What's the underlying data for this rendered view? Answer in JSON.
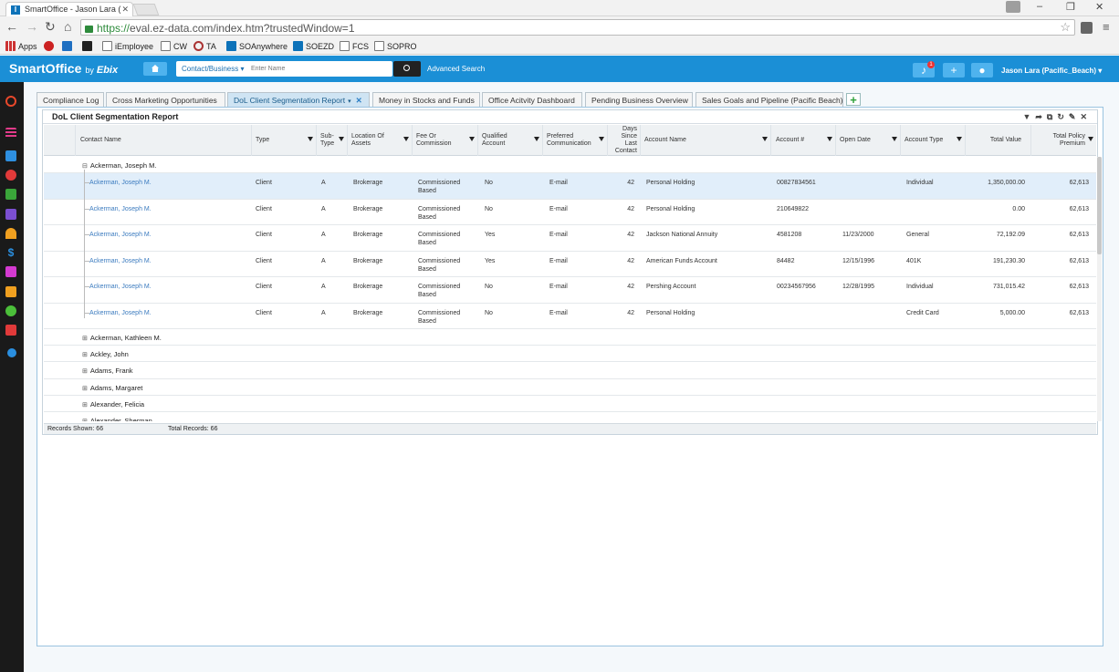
{
  "browser": {
    "tab_title": "SmartOffice - Jason Lara (",
    "url_https": "https://",
    "url_rest": "eval.ez-data.com/index.htm?trustedWindow=1",
    "bookmarks": [
      "Apps",
      "",
      "",
      "",
      "iEmployee",
      "CW",
      "TA",
      "SOAnywhere",
      "SOEZD",
      "FCS",
      "SOPRO"
    ]
  },
  "header": {
    "logo": "SmartOffice",
    "logo_by": "by",
    "logo_ebix": "Ebix",
    "search_scope": "Contact/Business ▾",
    "search_placeholder": "Enter Name",
    "advanced_search": "Advanced Search",
    "notification_count": "1",
    "user_name": "Jason Lara (Pacific_Beach) ▾"
  },
  "tabs": [
    {
      "label": "Compliance Log"
    },
    {
      "label": "Cross Marketing Opportunities"
    },
    {
      "label": "DoL Client Segmentation Report"
    },
    {
      "label": "Money in Stocks and Funds"
    },
    {
      "label": "Office Acitvity Dashboard"
    },
    {
      "label": "Pending Business Overview"
    },
    {
      "label": "Sales Goals and Pipeline (Pacific Beach)"
    }
  ],
  "report": {
    "title": "DoL Client Segmentation Report",
    "columns": {
      "contact_name": "Contact Name",
      "type": "Type",
      "sub_type_1": "Sub-",
      "sub_type_2": "Type",
      "location_1": "Location Of",
      "location_2": "Assets",
      "fee_1": "Fee Or",
      "fee_2": "Commission",
      "qualified_1": "Qualified",
      "qualified_2": "Account",
      "preferred_1": "Preferred",
      "preferred_2": "Communication",
      "days_1": "Days",
      "days_2": "Since",
      "days_3": "Last",
      "days_4": "Contact",
      "account_name": "Account Name",
      "account_num": "Account #",
      "open_date": "Open Date",
      "account_type": "Account Type",
      "total_value": "Total Value",
      "premium_1": "Total Policy",
      "premium_2": "Premium"
    },
    "expanded_group": "Ackerman, Joseph M.",
    "rows": [
      {
        "name": "Ackerman, Joseph M.",
        "type": "Client",
        "sub": "A",
        "loc": "Brokerage",
        "fee1": "Commissioned",
        "fee2": "Based",
        "qual": "No",
        "pref": "E-mail",
        "days": "42",
        "acct": "Personal Holding",
        "num": "00827834561",
        "open": "",
        "atype": "Individual",
        "value": "1,350,000.00",
        "prem": "62,613"
      },
      {
        "name": "Ackerman, Joseph M.",
        "type": "Client",
        "sub": "A",
        "loc": "Brokerage",
        "fee1": "Commissioned",
        "fee2": "Based",
        "qual": "No",
        "pref": "E-mail",
        "days": "42",
        "acct": "Personal Holding",
        "num": "210649822",
        "open": "",
        "atype": "",
        "value": "0.00",
        "prem": "62,613"
      },
      {
        "name": "Ackerman, Joseph M.",
        "type": "Client",
        "sub": "A",
        "loc": "Brokerage",
        "fee1": "Commissioned",
        "fee2": "Based",
        "qual": "Yes",
        "pref": "E-mail",
        "days": "42",
        "acct": "Jackson National Annuity",
        "num": "4581208",
        "open": "11/23/2000",
        "atype": "General",
        "value": "72,192.09",
        "prem": "62,613"
      },
      {
        "name": "Ackerman, Joseph M.",
        "type": "Client",
        "sub": "A",
        "loc": "Brokerage",
        "fee1": "Commissioned",
        "fee2": "Based",
        "qual": "Yes",
        "pref": "E-mail",
        "days": "42",
        "acct": "American Funds Account",
        "num": "84482",
        "open": "12/15/1996",
        "atype": "401K",
        "value": "191,230.30",
        "prem": "62,613"
      },
      {
        "name": "Ackerman, Joseph M.",
        "type": "Client",
        "sub": "A",
        "loc": "Brokerage",
        "fee1": "Commissioned",
        "fee2": "Based",
        "qual": "No",
        "pref": "E-mail",
        "days": "42",
        "acct": "Pershing Account",
        "num": "00234567956",
        "open": "12/28/1995",
        "atype": "Individual",
        "value": "731,015.42",
        "prem": "62,613"
      },
      {
        "name": "Ackerman, Joseph M.",
        "type": "Client",
        "sub": "A",
        "loc": "Brokerage",
        "fee1": "Commissioned",
        "fee2": "Based",
        "qual": "No",
        "pref": "E-mail",
        "days": "42",
        "acct": "Personal Holding",
        "num": "",
        "open": "",
        "atype": "Credit Card",
        "value": "5,000.00",
        "prem": "62,613"
      }
    ],
    "collapsed_groups": [
      "Ackerman, Kathleen M.",
      "Ackley, John",
      "Adams, Frank",
      "Adams, Margaret",
      "Alexander, Felicia",
      "Alexander, Sherman"
    ],
    "footer": {
      "records_shown": "Records Shown: 66",
      "total_records": "Total Records: 66"
    }
  }
}
